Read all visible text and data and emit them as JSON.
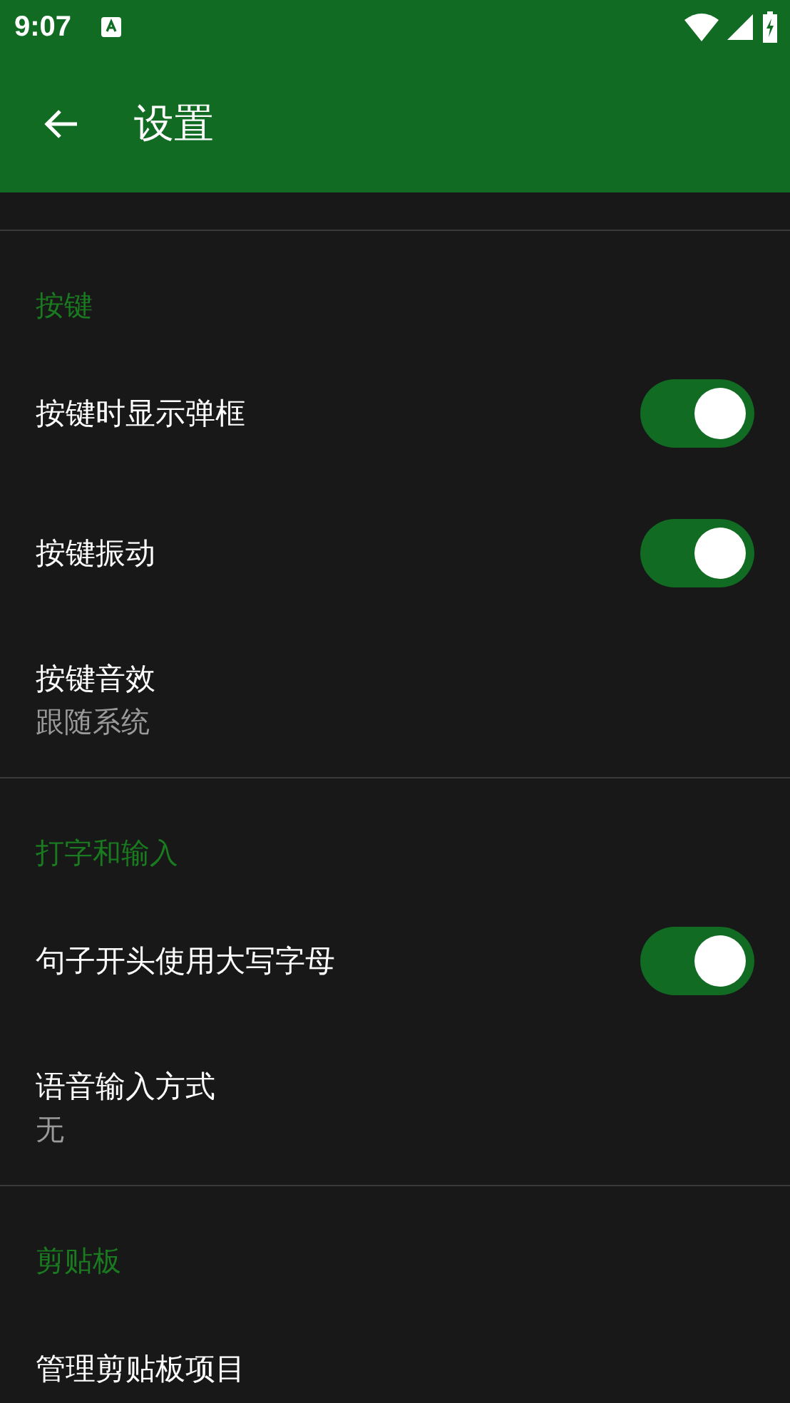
{
  "status_bar": {
    "time": "9:07"
  },
  "app_bar": {
    "title": "设置"
  },
  "sections": [
    {
      "title": "按键",
      "items": [
        {
          "kind": "switch",
          "title": "按键时显示弹框",
          "on": true
        },
        {
          "kind": "switch",
          "title": "按键振动",
          "on": true
        },
        {
          "kind": "value",
          "title": "按键音效",
          "summary": "跟随系统"
        }
      ]
    },
    {
      "title": "打字和输入",
      "items": [
        {
          "kind": "switch",
          "title": "句子开头使用大写字母",
          "on": true
        },
        {
          "kind": "value",
          "title": "语音输入方式",
          "summary": "无"
        }
      ]
    },
    {
      "title": "剪贴板",
      "items": [
        {
          "kind": "plain",
          "title": "管理剪贴板项目"
        }
      ]
    }
  ]
}
